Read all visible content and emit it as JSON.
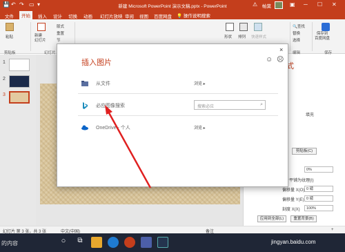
{
  "window": {
    "title": "新建 Microsoft PowerPoint 演示文稿.pptx  -  PowerPoint",
    "user": "帕莫",
    "warning_icon": "warning-icon",
    "brand_color": "#c43e1c"
  },
  "ribbon": {
    "tabs": [
      "文件",
      "开始",
      "插入",
      "设计",
      "切换",
      "动画",
      "幻灯片放映",
      "审阅",
      "视图",
      "百度网盘"
    ],
    "active_tab": "开始",
    "tell_me": "操作说明搜索",
    "labels": {
      "paste": "粘贴",
      "new_slide": "新建\n幻灯片",
      "layout": "版式",
      "reset": "重置",
      "section": "节",
      "shape": "形状",
      "arrange": "排列",
      "quick_styles": "快速样式",
      "find": "查找",
      "replace": "替换",
      "select": "选择",
      "save_to_baidu": "保存到\n百度网盘"
    },
    "groups": {
      "clipboard": "剪贴板",
      "slides": "幻灯片",
      "edit": "编辑",
      "save": "保存"
    }
  },
  "thumbnails": [
    "1",
    "2",
    "3"
  ],
  "dialog": {
    "title": "插入图片",
    "close": "×",
    "rows": [
      {
        "label": "从文件",
        "action": "浏览 ▸",
        "icon": "folder-icon"
      },
      {
        "label": "必应图像搜索",
        "placeholder": "搜索必应",
        "icon": "bing-icon"
      },
      {
        "label": "OneDrive - 个人",
        "action": "浏览 ▸",
        "icon": "onedrive-icon"
      }
    ]
  },
  "format_pane": {
    "title_partial": "式",
    "fill_partial": "填充",
    "clipboard_btn": "剪贴板(C)",
    "offset_x": "偏移量 X(O)",
    "offset_y": "偏移量 Y(E)",
    "scale_x": "刻度 X(X)",
    "offset_x_value": "0 磅",
    "offset_y_value": "0 磅",
    "scale_x_value": "100%",
    "transparency_value": "0%",
    "tile_label": "将图片平铺为纹理(I)",
    "apply_all": "应用到全部(L)",
    "reset_bg": "重置背景(B)"
  },
  "statusbar": {
    "slide_info": "幻灯片 第 3 张，共 3 张",
    "language": "中文(中国)",
    "notes": "备注",
    "zoom": "+"
  },
  "taskbar": {
    "search_text": "的内容",
    "watermark": "jingyan.baidu.com"
  }
}
